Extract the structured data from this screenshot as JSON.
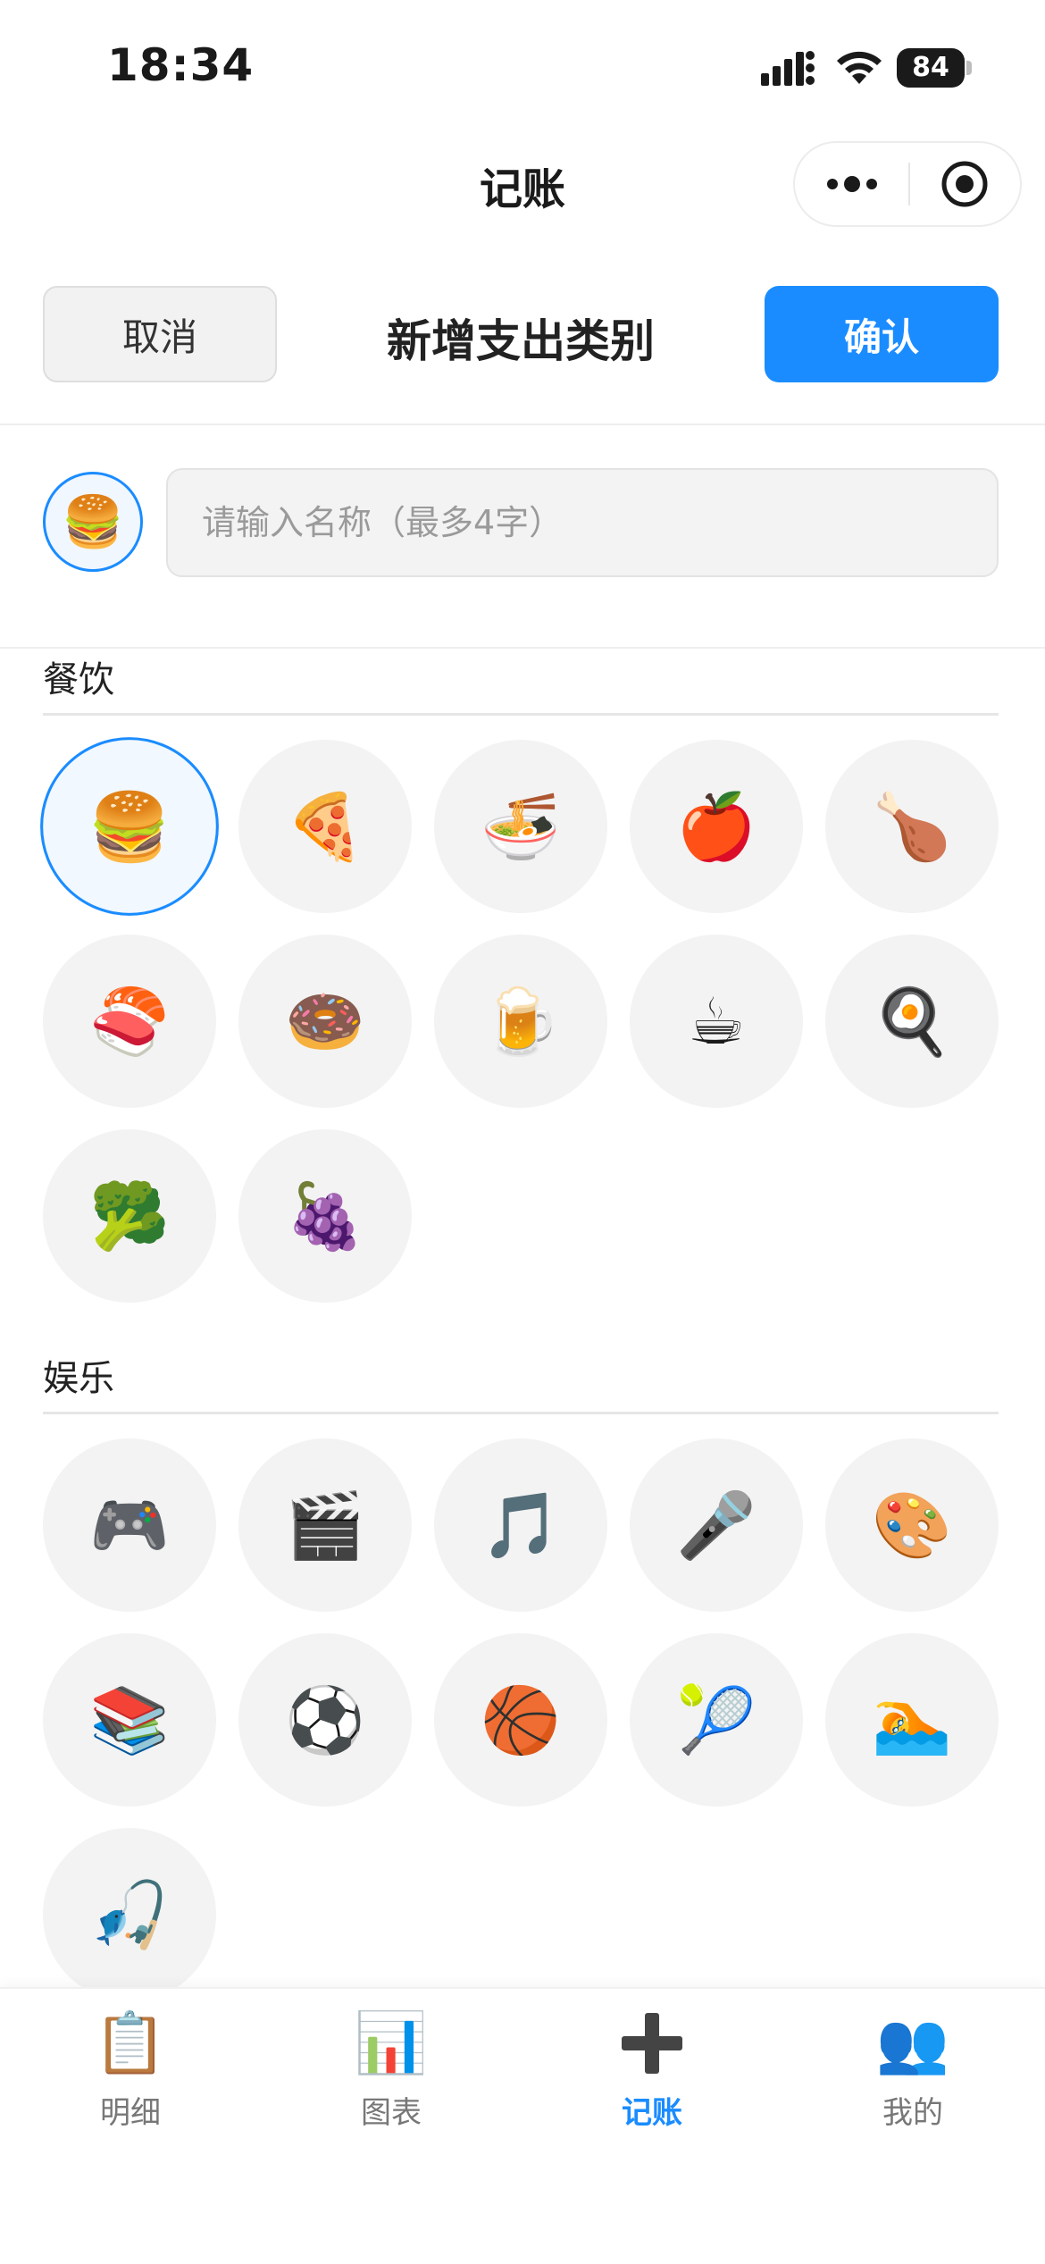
{
  "status_bar": {
    "time": "18:34",
    "battery": "84"
  },
  "nav": {
    "title": "记账"
  },
  "header": {
    "cancel_label": "取消",
    "title": "新增支出类别",
    "confirm_label": "确认"
  },
  "form": {
    "selected_icon": "🍔",
    "name_placeholder": "请输入名称（最多4字）",
    "name_value": ""
  },
  "sections": [
    {
      "label": "餐饮",
      "icons": [
        {
          "emoji": "🍔",
          "name": "hamburger-icon",
          "selected": true
        },
        {
          "emoji": "🍕",
          "name": "pizza-icon"
        },
        {
          "emoji": "🍜",
          "name": "noodles-icon"
        },
        {
          "emoji": "🍎",
          "name": "apple-icon"
        },
        {
          "emoji": "🍗",
          "name": "chicken-leg-icon"
        },
        {
          "emoji": "🍣",
          "name": "sushi-icon"
        },
        {
          "emoji": "🍩",
          "name": "donut-icon"
        },
        {
          "emoji": "🍺",
          "name": "beer-icon"
        },
        {
          "emoji": "☕",
          "name": "coffee-icon"
        },
        {
          "emoji": "🍳",
          "name": "frying-egg-icon"
        },
        {
          "emoji": "🥦",
          "name": "broccoli-icon"
        },
        {
          "emoji": "🍇",
          "name": "grapes-icon"
        }
      ]
    },
    {
      "label": "娱乐",
      "icons": [
        {
          "emoji": "🎮",
          "name": "game-controller-icon"
        },
        {
          "emoji": "🎬",
          "name": "clapper-board-icon"
        },
        {
          "emoji": "🎵",
          "name": "music-note-icon"
        },
        {
          "emoji": "🎤",
          "name": "microphone-icon"
        },
        {
          "emoji": "🎨",
          "name": "palette-icon"
        },
        {
          "emoji": "📚",
          "name": "books-icon"
        },
        {
          "emoji": "⚽",
          "name": "soccer-ball-icon"
        },
        {
          "emoji": "🏀",
          "name": "basketball-icon"
        },
        {
          "emoji": "🎾",
          "name": "tennis-ball-icon"
        },
        {
          "emoji": "🏊",
          "name": "swimmer-icon"
        },
        {
          "emoji": "🎣",
          "name": "fishing-icon"
        }
      ]
    }
  ],
  "tab_bar": [
    {
      "label": "明细",
      "icon": "📋",
      "icon_name": "clipboard-icon",
      "active": false
    },
    {
      "label": "图表",
      "icon": "📊",
      "icon_name": "bar-chart-icon",
      "active": false
    },
    {
      "label": "记账",
      "icon": "+",
      "icon_name": "plus-icon",
      "active": true
    },
    {
      "label": "我的",
      "icon": "👥",
      "icon_name": "users-icon",
      "active": false
    }
  ],
  "colors": {
    "accent": "#1a8cff",
    "cell_bg": "#f3f3f3",
    "text": "#1a1a1a"
  }
}
